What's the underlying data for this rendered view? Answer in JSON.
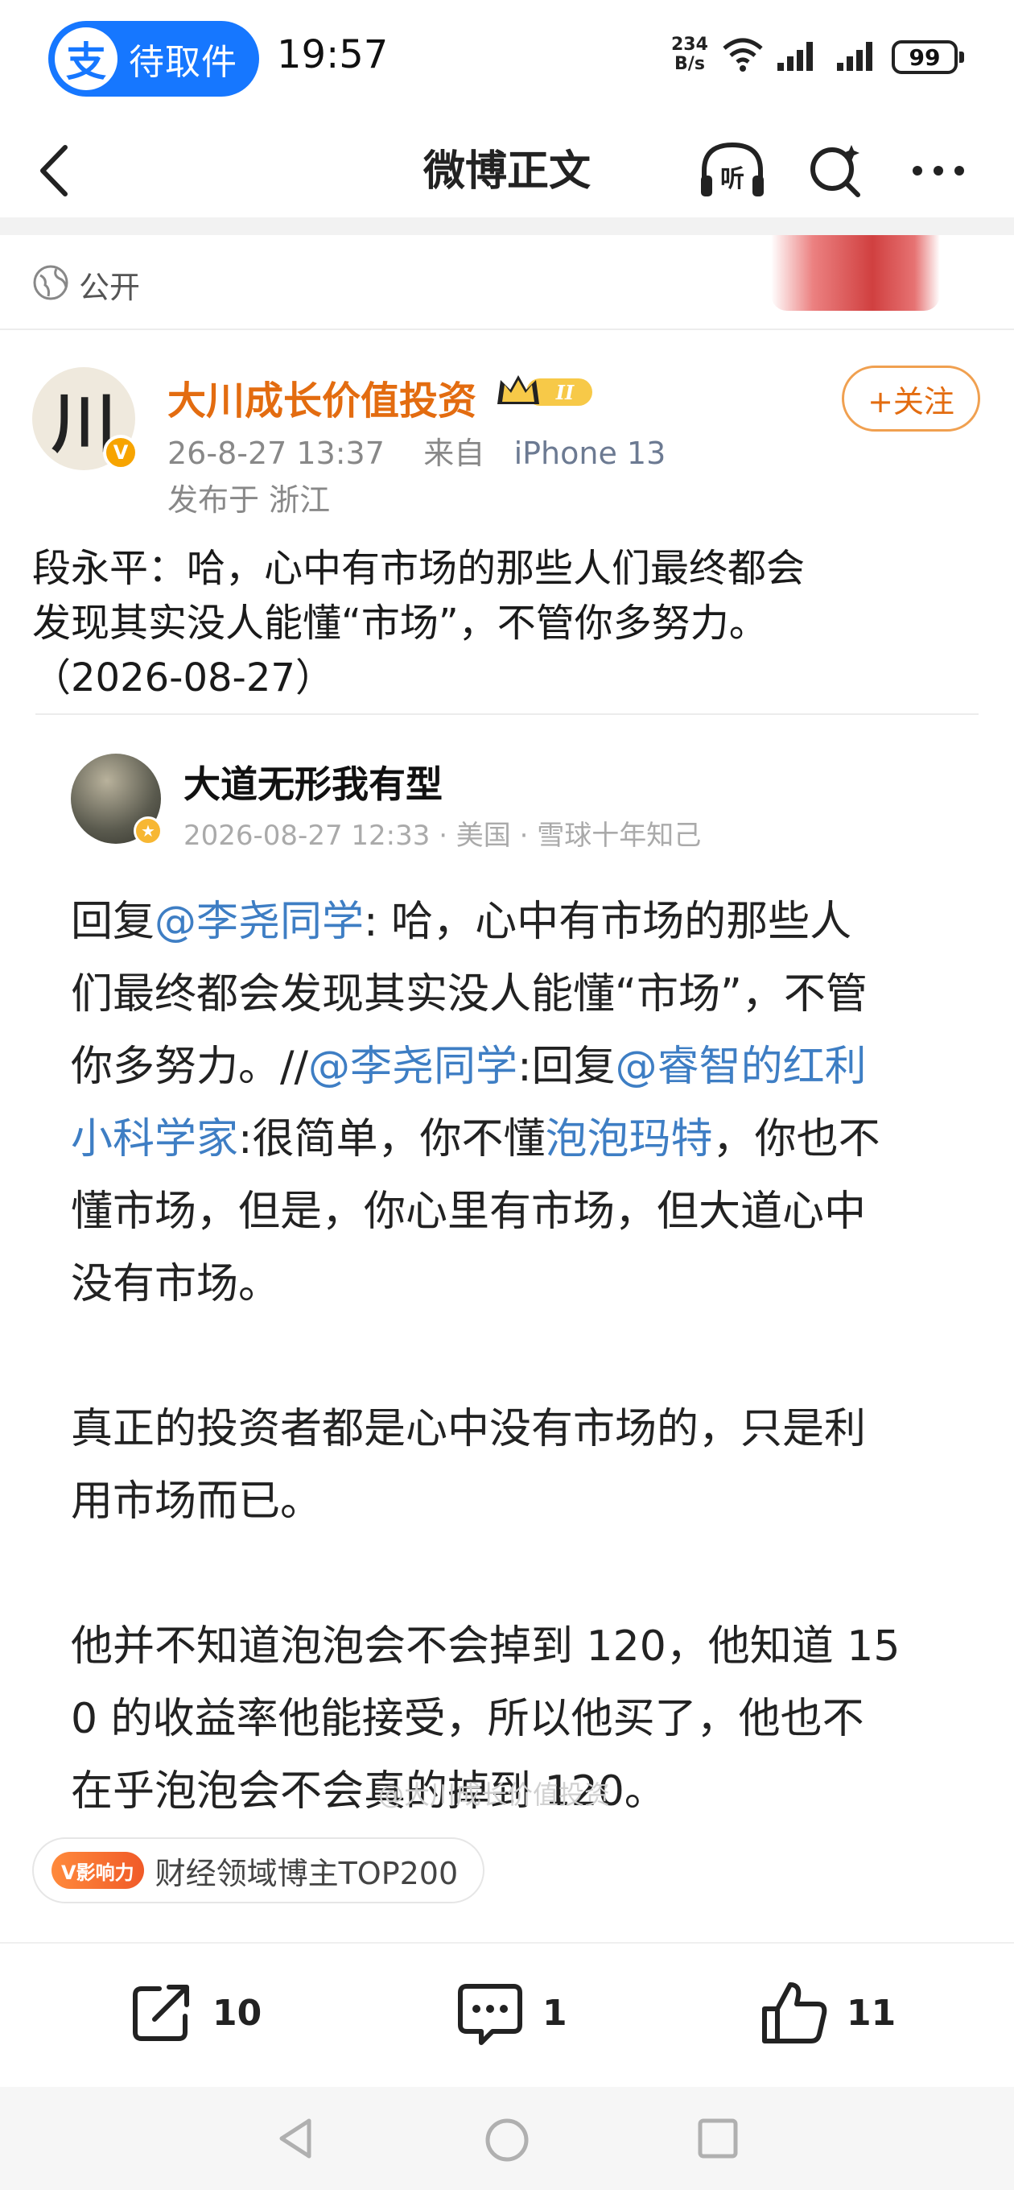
{
  "status_bar": {
    "pill_logo": "支",
    "pill_label": "待取件",
    "time": "19:57",
    "net_speed_value": "234",
    "net_speed_unit": "B/s",
    "battery": "99"
  },
  "nav": {
    "title": "微博正文"
  },
  "visibility": {
    "label": "公开"
  },
  "author": {
    "avatar_char": "川",
    "verified_mark": "V",
    "name": "大川成长价值投资",
    "level_badge": "II",
    "date": "26-8-27 13:37",
    "from_label": "来自",
    "device": "iPhone 13",
    "location": "发布于 浙江",
    "follow_label": "+关注"
  },
  "post": {
    "lines": [
      "段永平：哈，心中有市场的那些人们最终都会",
      "发现其实没人能懂“市场”，不管你多努力。",
      "（2026-08-27）"
    ]
  },
  "quoted": {
    "name": "大道无形我有型",
    "meta": "2026-08-27 12:33 · 美国 · 雪球十年知己",
    "p1": {
      "l1_a": "回复",
      "l1_link": "@李尧同学",
      "l1_b": ": 哈，心中有市场的那些人",
      "l2": "们最终都会发现其实没人能懂“市场”，不管",
      "l3_a": "你多努力。//",
      "l3_link1": "@李尧同学",
      "l3_b": ":回复",
      "l3_link2": "@睿智的红利",
      "l4_link": "小科学家",
      "l4_a": ":很简单，你不懂",
      "l4_link2": "泡泡玛特",
      "l4_b": "，你也不",
      "l5": "懂市场，但是，你心里有市场，但大道心中",
      "l6": "没有市场。"
    },
    "p2": {
      "l1": "真正的投资者都是心中没有市场的，只是利",
      "l2": "用市场而已。"
    },
    "p3": {
      "l1": "他并不知道泡泡会不会掉到 120，他知道 15",
      "l2": "0 的收益率他能接受，所以他买了，他也不",
      "l3": "在乎泡泡会不会真的掉到 120。"
    }
  },
  "watermark": "@大川成长价值投资",
  "influence": {
    "badge": "V影响力",
    "label": "财经领域博主TOP200"
  },
  "actions": {
    "repost_count": "10",
    "comment_count": "1",
    "like_count": "11"
  },
  "colors": {
    "accent_orange": "#e36c10",
    "link_blue": "#3e7ec4",
    "pill_blue": "#1677ff"
  }
}
